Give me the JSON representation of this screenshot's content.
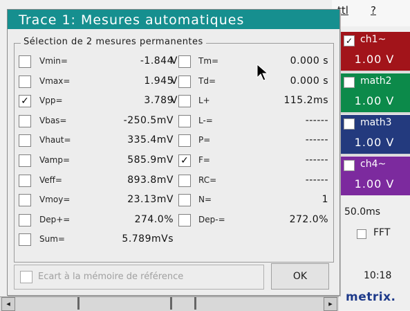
{
  "menubar": {
    "items": [
      "ttl",
      "?"
    ]
  },
  "dialog": {
    "title": "Trace 1: Mesures automatiques",
    "group_label": "Sélection de 2 mesures permanentes",
    "left_column": [
      {
        "label": "Vmin=",
        "value": "-1.844",
        "unit": "V",
        "checked": false
      },
      {
        "label": "Vmax=",
        "value": "1.945",
        "unit": "V",
        "checked": false
      },
      {
        "label": "Vpp=",
        "value": "3.789",
        "unit": "V",
        "checked": true
      },
      {
        "label": "Vbas=",
        "value": "-250.5mV",
        "unit": "",
        "checked": false
      },
      {
        "label": "Vhaut=",
        "value": "335.4mV",
        "unit": "",
        "checked": false
      },
      {
        "label": "Vamp=",
        "value": "585.9mV",
        "unit": "",
        "checked": false
      },
      {
        "label": "Veff=",
        "value": "893.8mV",
        "unit": "",
        "checked": false
      },
      {
        "label": "Vmoy=",
        "value": "23.13mV",
        "unit": "",
        "checked": false
      },
      {
        "label": "Dep+=",
        "value": "274.0%",
        "unit": "",
        "checked": false
      },
      {
        "label": "Sum=",
        "value": "5.789mVs",
        "unit": "",
        "checked": false
      }
    ],
    "right_column": [
      {
        "label": "Tm=",
        "value": "0.000 s",
        "checked": false
      },
      {
        "label": "Td=",
        "value": "0.000 s",
        "checked": false
      },
      {
        "label": "L+",
        "value": "115.2ms",
        "checked": false
      },
      {
        "label": "L-=",
        "value": "------",
        "checked": false
      },
      {
        "label": "P=",
        "value": "------",
        "checked": false
      },
      {
        "label": "F=",
        "value": "------",
        "checked": true
      },
      {
        "label": "RC=",
        "value": "------",
        "checked": false
      },
      {
        "label": "N=",
        "value": "1",
        "checked": false
      },
      {
        "label": "Dep-=",
        "value": "272.0%",
        "checked": false
      }
    ],
    "reference_label": "Ecart à la mémoire de référence",
    "reference_checked": false,
    "ok_label": "OK"
  },
  "channels": [
    {
      "name": "ch1~",
      "value": "1.00 V",
      "color": "#a2141a",
      "checked": true
    },
    {
      "name": "math2",
      "value": "1.00 V",
      "color": "#0c8a4a",
      "checked": false
    },
    {
      "name": "math3",
      "value": "1.00 V",
      "color": "#233a7e",
      "checked": false
    },
    {
      "name": "ch4~",
      "value": "1.00 V",
      "color": "#7c2a9e",
      "checked": false
    }
  ],
  "timebase": "50.0ms",
  "fft_label": "FFT",
  "clock": "10:18",
  "logo": "metrix.",
  "scrollbar": {
    "left_arrow": "◂",
    "right_arrow": "▸"
  }
}
